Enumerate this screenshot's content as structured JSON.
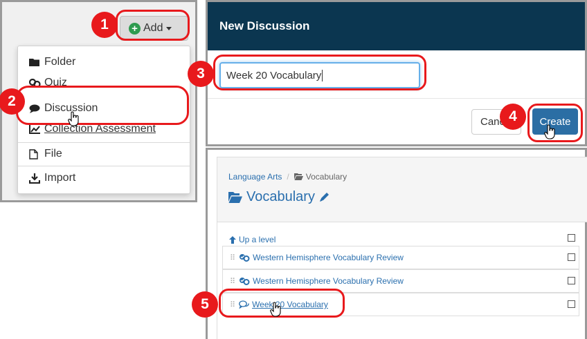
{
  "add_menu": {
    "add_button": {
      "label": "Add",
      "icon": "plus-circle-icon"
    },
    "items": [
      {
        "label": "Folder",
        "icon": "folder-icon"
      },
      {
        "label": "Quiz",
        "icon": "quiz-icon"
      },
      {
        "label": "Discussion",
        "icon": "chat-bubble-icon"
      },
      {
        "label": "Collection Assessment",
        "icon": "chart-icon"
      },
      {
        "label": "File",
        "icon": "file-icon"
      },
      {
        "label": "Import",
        "icon": "import-icon"
      }
    ]
  },
  "new_discussion": {
    "title": "New Discussion",
    "title_input_value": "Week 20 Vocabulary",
    "cancel_label": "Cancel",
    "create_label": "Create"
  },
  "folder_view": {
    "breadcrumb": [
      {
        "label": "Language Arts"
      },
      {
        "label": "Vocabulary",
        "icon": "folder-open-icon"
      }
    ],
    "folder_title": "Vocabulary",
    "up_level_label": "Up a level",
    "rows": [
      {
        "label": "Western Hemisphere Vocabulary Review",
        "icon": "quiz-icon"
      },
      {
        "label": "Western Hemisphere Vocabulary Review",
        "icon": "quiz-icon"
      },
      {
        "label": "Week 20 Vocabulary",
        "icon": "discussion-icon"
      }
    ]
  },
  "annotations": {
    "steps": [
      "1",
      "2",
      "3",
      "4",
      "5"
    ],
    "highlight_color": "#e8191c"
  },
  "colors": {
    "modal_header": "#0b3650",
    "create_button": "#2b6ea4",
    "link": "#2a6fae",
    "add_icon": "#2e9b4f"
  }
}
